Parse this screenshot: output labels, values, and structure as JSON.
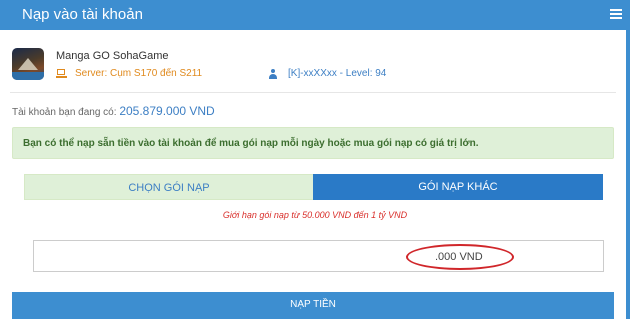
{
  "header": {
    "title": "Nạp vào tài khoản",
    "menu_icon": "hamburger-menu-icon"
  },
  "game": {
    "name": "Manga GO SohaGame",
    "server": "Server: Cụm S170 đến S211",
    "account": "[K]-xxXXxx - Level: 94"
  },
  "balance": {
    "label": "Tài khoản bạn đang có:",
    "amount": "205.879.000 VND"
  },
  "notice": {
    "text": "Bạn có thể nạp sẵn tiền vào tài khoản để mua gói nạp mỗi ngày hoặc mua gói nạp có giá trị lớn."
  },
  "tabs": [
    {
      "label": "CHỌN GÓI NẠP"
    },
    {
      "label": "GÓI NẠP KHÁC"
    }
  ],
  "limit_text": "Giới hạn gói nạp từ 50.000 VND đến 1 tỷ VND",
  "amount_input": {
    "value": ".000 VND"
  },
  "submit_label": "NẠP TIỀN",
  "colors": {
    "primary": "#3d8ed0",
    "active_tab": "#2a7ac7",
    "notice_bg": "#dff0d8",
    "error_red": "#d9302c",
    "server_orange": "#e08a1e"
  }
}
